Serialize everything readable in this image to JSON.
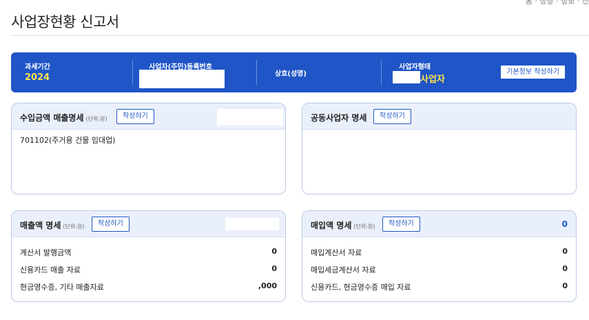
{
  "page": {
    "title": "사업장현황 신고서",
    "crumb": "홈 · 상장 · 정보 · 신"
  },
  "info": {
    "period_label": "과세기간",
    "period_value": "2024",
    "regno_label": "사업자(주민)등록번호",
    "name_label": "상호(성명)",
    "type_label": "사업자형태",
    "type_value": "사업자",
    "basic_button": "기본정보 작성하기"
  },
  "income": {
    "title": "수입금액 매출명세",
    "unit": "(단위:원)",
    "button": "작성하기",
    "code": "701102(주거용 건물 임대업)"
  },
  "partner": {
    "title": "공동사업자 명세",
    "button": "작성하기"
  },
  "sales": {
    "title": "매출액 명세",
    "unit": "(단위:원)",
    "button": "작성하기",
    "rows": [
      {
        "label": "계산서 발행금액",
        "value": "0"
      },
      {
        "label": "신용카드 매출 자료",
        "value": "0"
      },
      {
        "label": "현금영수증, 기타 매출자료",
        "value": ",000"
      }
    ]
  },
  "purchase": {
    "title": "매입액 명세",
    "unit": "(단위:원)",
    "button": "작성하기",
    "total": "0",
    "rows": [
      {
        "label": "매입계산서 자료",
        "value": "0"
      },
      {
        "label": "매입세금계산서 자료",
        "value": "0"
      },
      {
        "label": "신용카드, 현금영수증 매입 자료",
        "value": "0"
      }
    ]
  },
  "colors": {
    "primary": "#1f55c7",
    "highlight": "#ffe34d",
    "card_head": "#eaf0fb",
    "card_border": "#b9c9e6"
  }
}
